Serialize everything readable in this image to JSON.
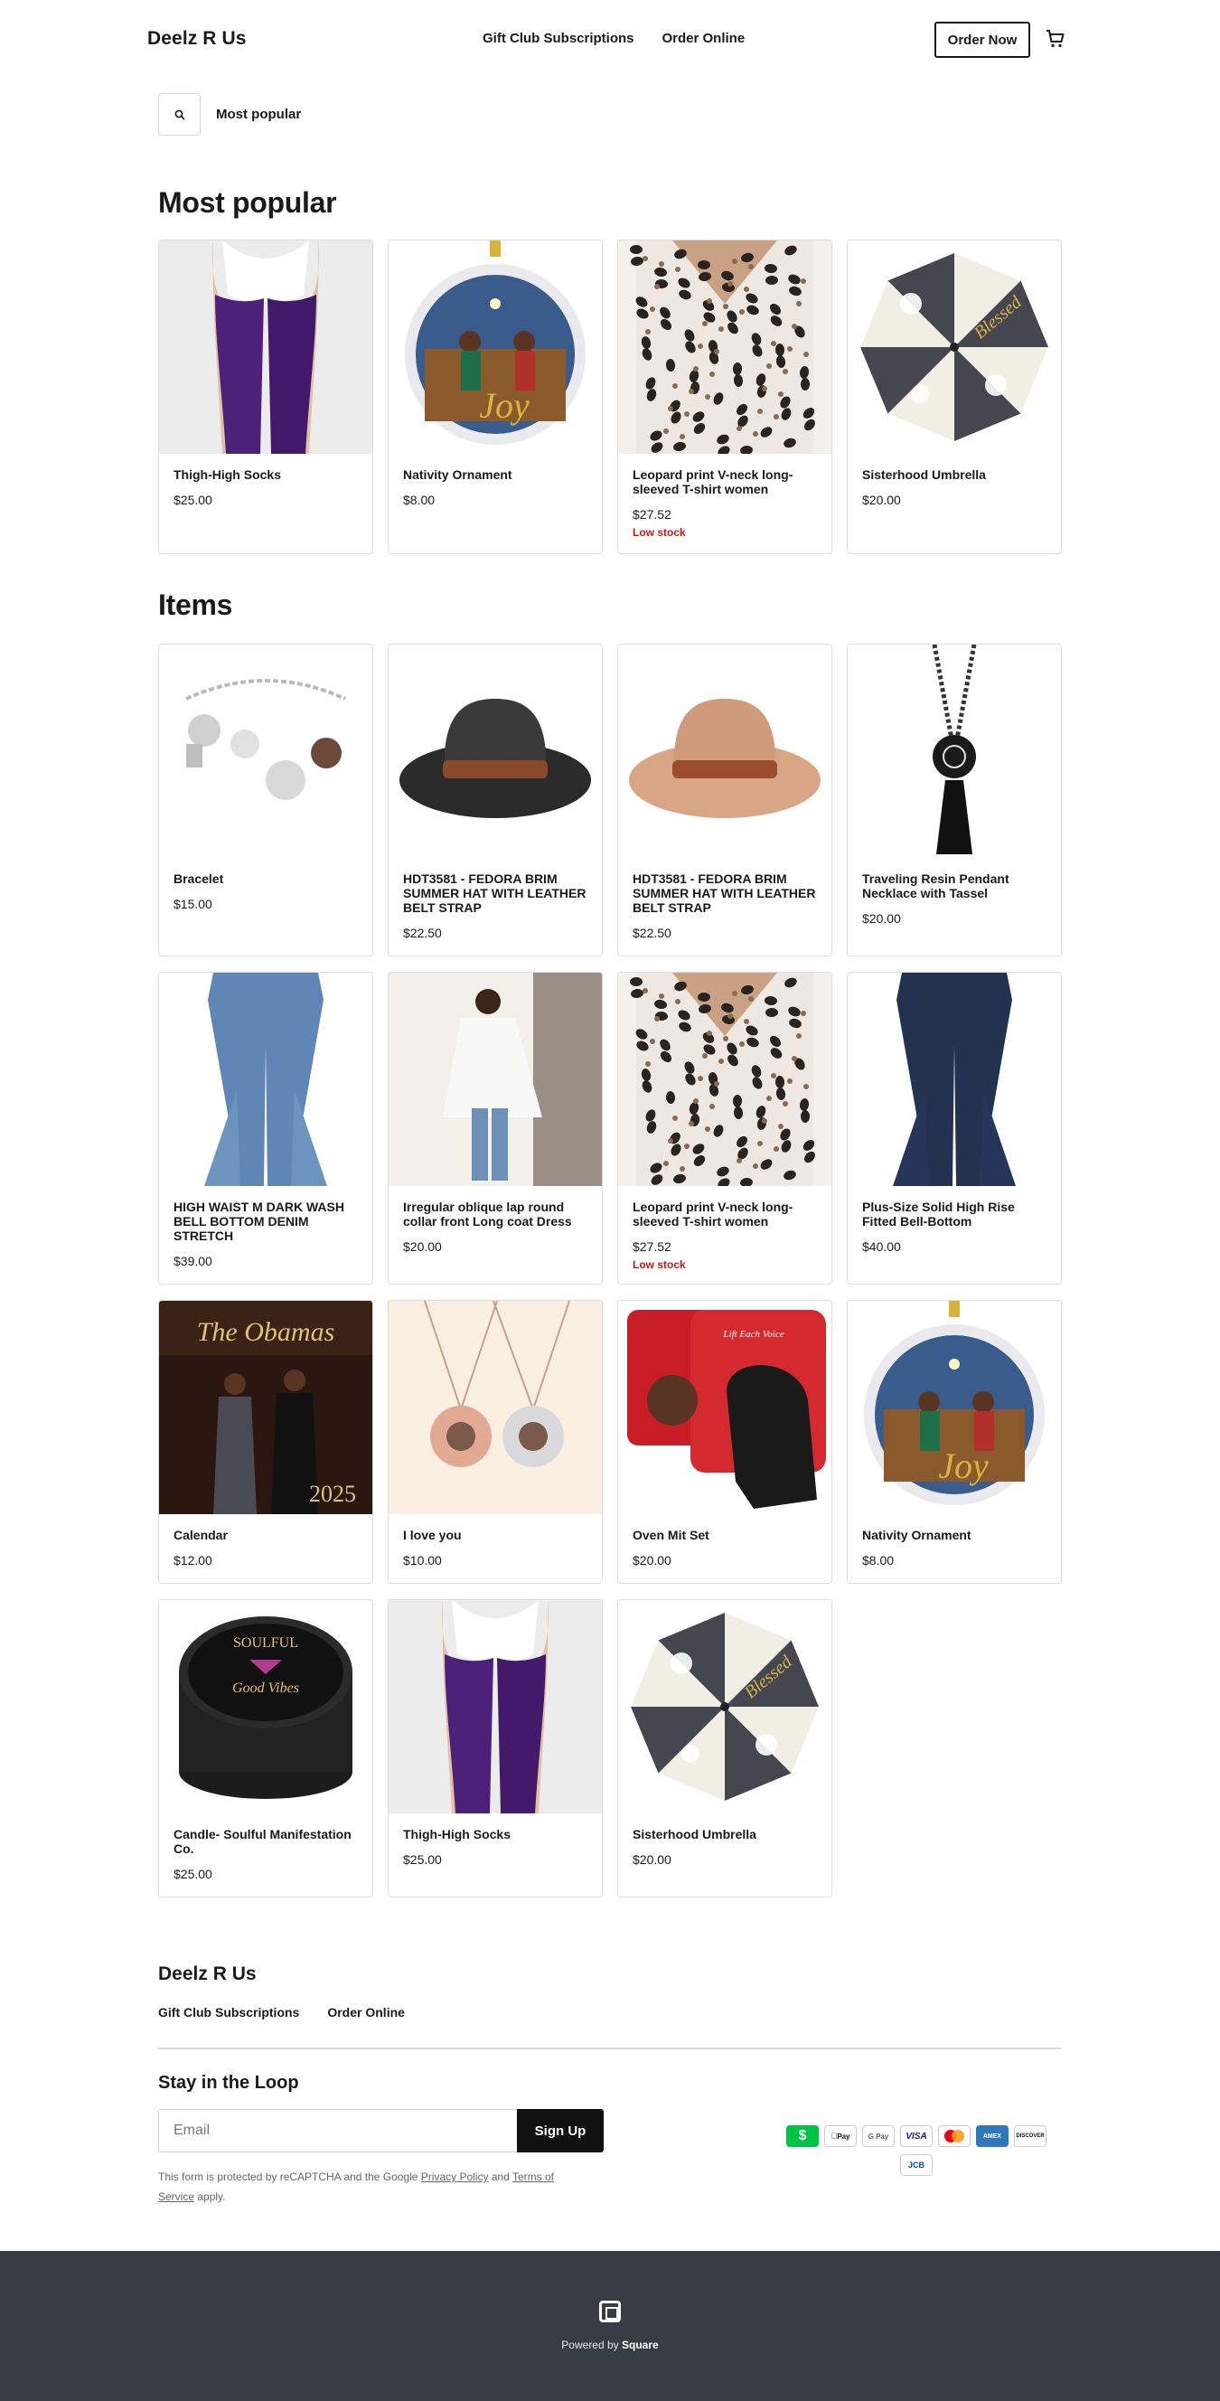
{
  "header": {
    "brand": "Deelz R Us",
    "nav": [
      "Gift Club Subscriptions",
      "Order Online"
    ],
    "order_button": "Order Now"
  },
  "search": {
    "label": "Most popular"
  },
  "sections": {
    "popular_title": "Most popular",
    "items_title": "Items"
  },
  "popular": [
    {
      "name": "Thigh-High Socks",
      "price": "$25.00",
      "stock": "",
      "image": "purple-socks"
    },
    {
      "name": "Nativity Ornament",
      "price": "$8.00",
      "stock": "",
      "image": "nativity-ornament"
    },
    {
      "name": "Leopard print V-neck long-sleeved T-shirt women",
      "price": "$27.52",
      "stock": "Low stock",
      "image": "leopard-shirt"
    },
    {
      "name": "Sisterhood Umbrella",
      "price": "$20.00",
      "stock": "",
      "image": "umbrella"
    }
  ],
  "items": [
    {
      "name": "Bracelet",
      "price": "$15.00",
      "stock": "",
      "image": "bracelet"
    },
    {
      "name": "HDT3581 - FEDORA BRIM SUMMER HAT WITH LEATHER BELT STRAP",
      "price": "$22.50",
      "stock": "",
      "image": "black-fedora"
    },
    {
      "name": "HDT3581 - FEDORA BRIM SUMMER HAT WITH LEATHER BELT STRAP",
      "price": "$22.50",
      "stock": "",
      "image": "tan-fedora"
    },
    {
      "name": "Traveling Resin Pendant Necklace with Tassel",
      "price": "$20.00",
      "stock": "",
      "image": "pendant-necklace"
    },
    {
      "name": "HIGH WAIST M DARK WASH BELL BOTTOM DENIM STRETCH",
      "price": "$39.00",
      "stock": "",
      "image": "light-jeans"
    },
    {
      "name": "Irregular oblique lap round collar front Long coat Dress",
      "price": "$20.00",
      "stock": "",
      "image": "white-coat"
    },
    {
      "name": "Leopard print V-neck long-sleeved T-shirt women",
      "price": "$27.52",
      "stock": "Low stock",
      "image": "leopard-shirt"
    },
    {
      "name": "Plus-Size Solid High Rise Fitted Bell-Bottom",
      "price": "$40.00",
      "stock": "",
      "image": "dark-jeans"
    },
    {
      "name": "Calendar",
      "price": "$12.00",
      "stock": "",
      "image": "calendar"
    },
    {
      "name": "I love you",
      "price": "$10.00",
      "stock": "",
      "image": "necklaces"
    },
    {
      "name": "Oven Mit Set",
      "price": "$20.00",
      "stock": "",
      "image": "oven-mitt"
    },
    {
      "name": "Nativity Ornament",
      "price": "$8.00",
      "stock": "",
      "image": "nativity-ornament"
    },
    {
      "name": "Candle- Soulful Manifestation Co.",
      "price": "$25.00",
      "stock": "",
      "image": "candle"
    },
    {
      "name": "Thigh-High Socks",
      "price": "$25.00",
      "stock": "",
      "image": "purple-socks"
    },
    {
      "name": "Sisterhood Umbrella",
      "price": "$20.00",
      "stock": "",
      "image": "umbrella"
    }
  ],
  "image_text": {
    "calendar_title": "The Obamas",
    "calendar_year": "2025",
    "ornament_word": "Joy",
    "umbrella_word": "Blessed",
    "candle_brand": "SOULFUL",
    "candle_label": "Good Vibes",
    "ornament_card": "Lift Each Voice"
  },
  "footer": {
    "brand": "Deelz R Us",
    "nav": [
      "Gift Club Subscriptions",
      "Order Online"
    ],
    "loop_title": "Stay in the Loop",
    "email_placeholder": "Email",
    "signup": "Sign Up",
    "recaptcha_prefix": "This form is protected by reCAPTCHA and the Google ",
    "privacy": "Privacy Policy",
    "and": " and ",
    "terms": "Terms of Service",
    "recaptcha_suffix": " apply.",
    "payments": [
      "cash-app",
      "apple-pay",
      "google-pay",
      "visa",
      "mastercard",
      "amex",
      "discover",
      "jcb"
    ],
    "payment_labels": {
      "apple": "Pay",
      "google": "G Pay",
      "visa": "VISA",
      "amex": "AMEX",
      "discover": "DISCOVER",
      "jcb": "JCB"
    },
    "powered_prefix": "Powered by ",
    "powered_brand": "Square"
  },
  "colors": {
    "low_stock": "#c21a1a",
    "footer_bg": "#373d44",
    "cash_app": "#00c244",
    "amex": "#2e77bc"
  }
}
